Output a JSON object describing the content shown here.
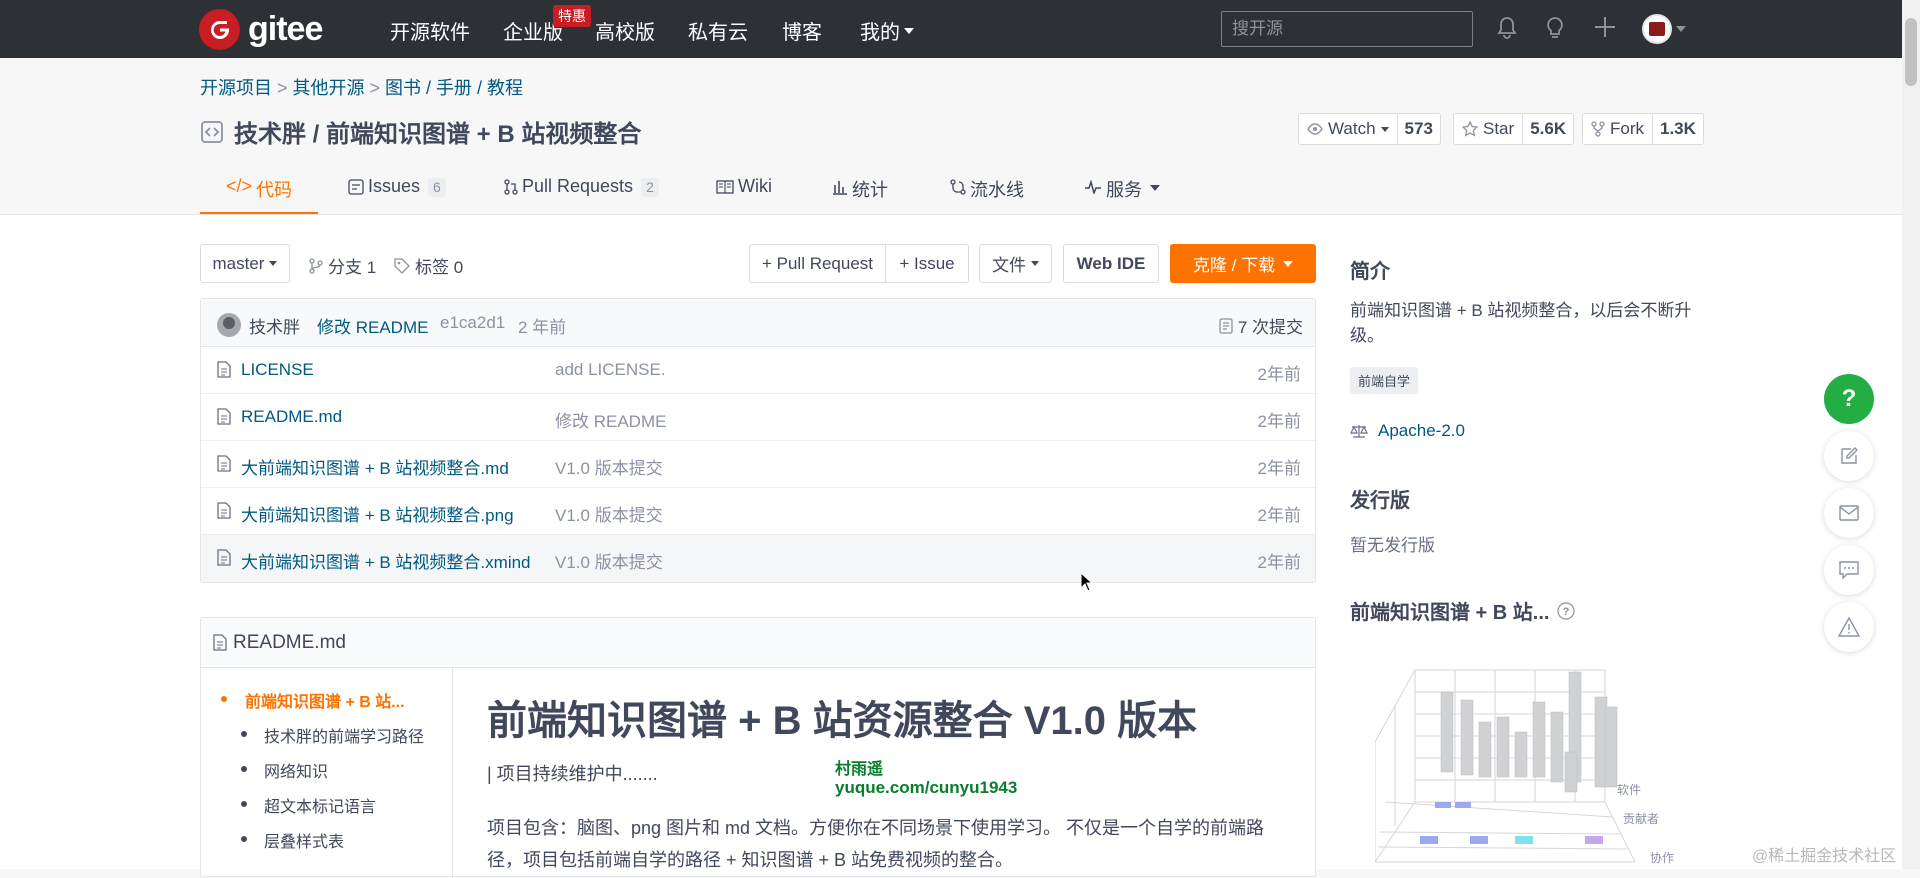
{
  "nav": {
    "brand": "gitee",
    "items": [
      "开源软件",
      "企业版",
      "高校版",
      "私有云",
      "博客",
      "我的"
    ],
    "badge": "特惠",
    "search_placeholder": "搜开源"
  },
  "breadcrumb": [
    "开源项目",
    "其他开源",
    "图书 / 手册 / 教程"
  ],
  "repo": {
    "title": "技术胖 / 前端知识图谱 + B 站视频整合",
    "watch_label": "Watch",
    "watch_count": "573",
    "star_label": "Star",
    "star_count": "5.6K",
    "fork_label": "Fork",
    "fork_count": "1.3K"
  },
  "tabs": [
    {
      "label": "代码"
    },
    {
      "label": "Issues",
      "count": "6"
    },
    {
      "label": "Pull Requests",
      "count": "2"
    },
    {
      "label": "Wiki"
    },
    {
      "label": "统计"
    },
    {
      "label": "流水线"
    },
    {
      "label": "服务"
    }
  ],
  "toolbar": {
    "branch": "master",
    "branches": "分支 1",
    "tags": "标签 0",
    "pull_request": "+ Pull Request",
    "issue": "+ Issue",
    "files": "文件",
    "web_ide": "Web IDE",
    "clone": "克隆 / 下载"
  },
  "last_commit": {
    "author": "技术胖",
    "message": "修改 README",
    "hash": "e1ca2d1",
    "time": "2 年前",
    "commits": "7 次提交"
  },
  "files": [
    {
      "name": "LICENSE",
      "message": "add LICENSE.",
      "time": "2年前"
    },
    {
      "name": "README.md",
      "message": "修改 README",
      "time": "2年前"
    },
    {
      "name": "大前端知识图谱 + B 站视频整合.md",
      "message": "V1.0 版本提交",
      "time": "2年前"
    },
    {
      "name": "大前端知识图谱 + B 站视频整合.png",
      "message": "V1.0 版本提交",
      "time": "2年前"
    },
    {
      "name": "大前端知识图谱 + B 站视频整合.xmind",
      "message": "V1.0 版本提交",
      "time": "2年前"
    }
  ],
  "readme": {
    "filename": "README.md",
    "toc": [
      "前端知识图谱 + B 站...",
      "技术胖的前端学习路径",
      "网络知识",
      "超文本标记语言",
      "层叠样式表"
    ],
    "heading": "前端知识图谱 + B 站资源整合 V1.0 版本",
    "line1": "| 项目持续维护中.......",
    "para": "项目包含：脑图、png 图片和 md 文档。方便你在不同场景下使用学习。 不仅是一个自学的前端路径，项目包括前端自学的路径 + 知识图谱 + B 站免费视频的整合。",
    "watermark_name": "村雨遥",
    "watermark_url": "yuque.com/cunyu1943"
  },
  "sidebar": {
    "intro_title": "简介",
    "intro_text": "前端知识图谱 + B 站视频整合，以后会不断升级。",
    "tag": "前端自学",
    "license": "Apache-2.0",
    "release_title": "发行版",
    "release_text": "暂无发行版",
    "metric_title": "前端知识图谱 + B 站...",
    "chart_axis": [
      "软件",
      "贡献者",
      "协作"
    ]
  },
  "footer_watermark": "@稀土掘金技术社区",
  "colors": {
    "accent": "#fe7300",
    "nav_bg": "#2d3035",
    "link": "#005980",
    "help_green": "#22ae42"
  }
}
